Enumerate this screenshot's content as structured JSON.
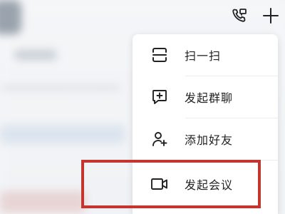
{
  "menu": {
    "items": [
      {
        "label": "扫一扫",
        "icon": "scan-icon"
      },
      {
        "label": "发起群聊",
        "icon": "group-chat-icon"
      },
      {
        "label": "添加好友",
        "icon": "add-friend-icon"
      },
      {
        "label": "发起会议",
        "icon": "video-meeting-icon"
      }
    ]
  },
  "header": {
    "call_icon": "phone-call-icon",
    "add_icon": "plus-icon"
  },
  "highlight": {
    "color": "#c2362f",
    "target": "发起会议"
  }
}
